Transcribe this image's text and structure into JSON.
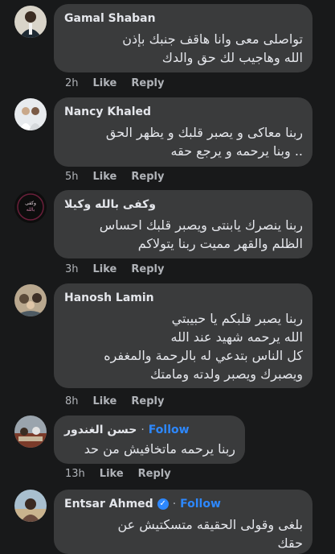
{
  "comments": [
    {
      "author": "Gamal Shaban",
      "text": "تواصلى معى وانا هاقف جنبك بإذن\nالله وهاجيب لك حق والدك",
      "time": "2h",
      "like": "Like",
      "reply": "Reply"
    },
    {
      "author": "Nancy Khaled",
      "text": "ربنا معاكى و يصبر قلبك و يظهر الحق\n.. وبنا يرحمه و يرجع حقه",
      "time": "5h",
      "like": "Like",
      "reply": "Reply"
    },
    {
      "author": "وكفى بالله وكيلا",
      "text": "ربنا ينصرك يابنتى ويصبر قلبك احساس\nالظلم والقهر مميت ربنا يتولاكم",
      "time": "3h",
      "like": "Like",
      "reply": "Reply"
    },
    {
      "author": "Hanosh Lamin",
      "text": "ربنا يصبر قلبكم يا حبيبتي\nالله يرحمه شهيد عند الله\nكل الناس بتدعي له بالرحمة والمغفره\nويصبرك ويصبر ولدته ومامتك",
      "time": "8h",
      "like": "Like",
      "reply": "Reply"
    },
    {
      "author": "حسن الغندور",
      "follow": "Follow",
      "text": "ربنا يرحمه ماتخافيش من حد",
      "time": "13h",
      "like": "Like",
      "reply": "Reply"
    },
    {
      "author": "Entsar Ahmed",
      "follow": "Follow",
      "text": "بلغى وقولى الحقيقه متسكتيش عن\nحقك"
    }
  ],
  "separator": "·",
  "icons": [
    "verified-badge-icon"
  ]
}
